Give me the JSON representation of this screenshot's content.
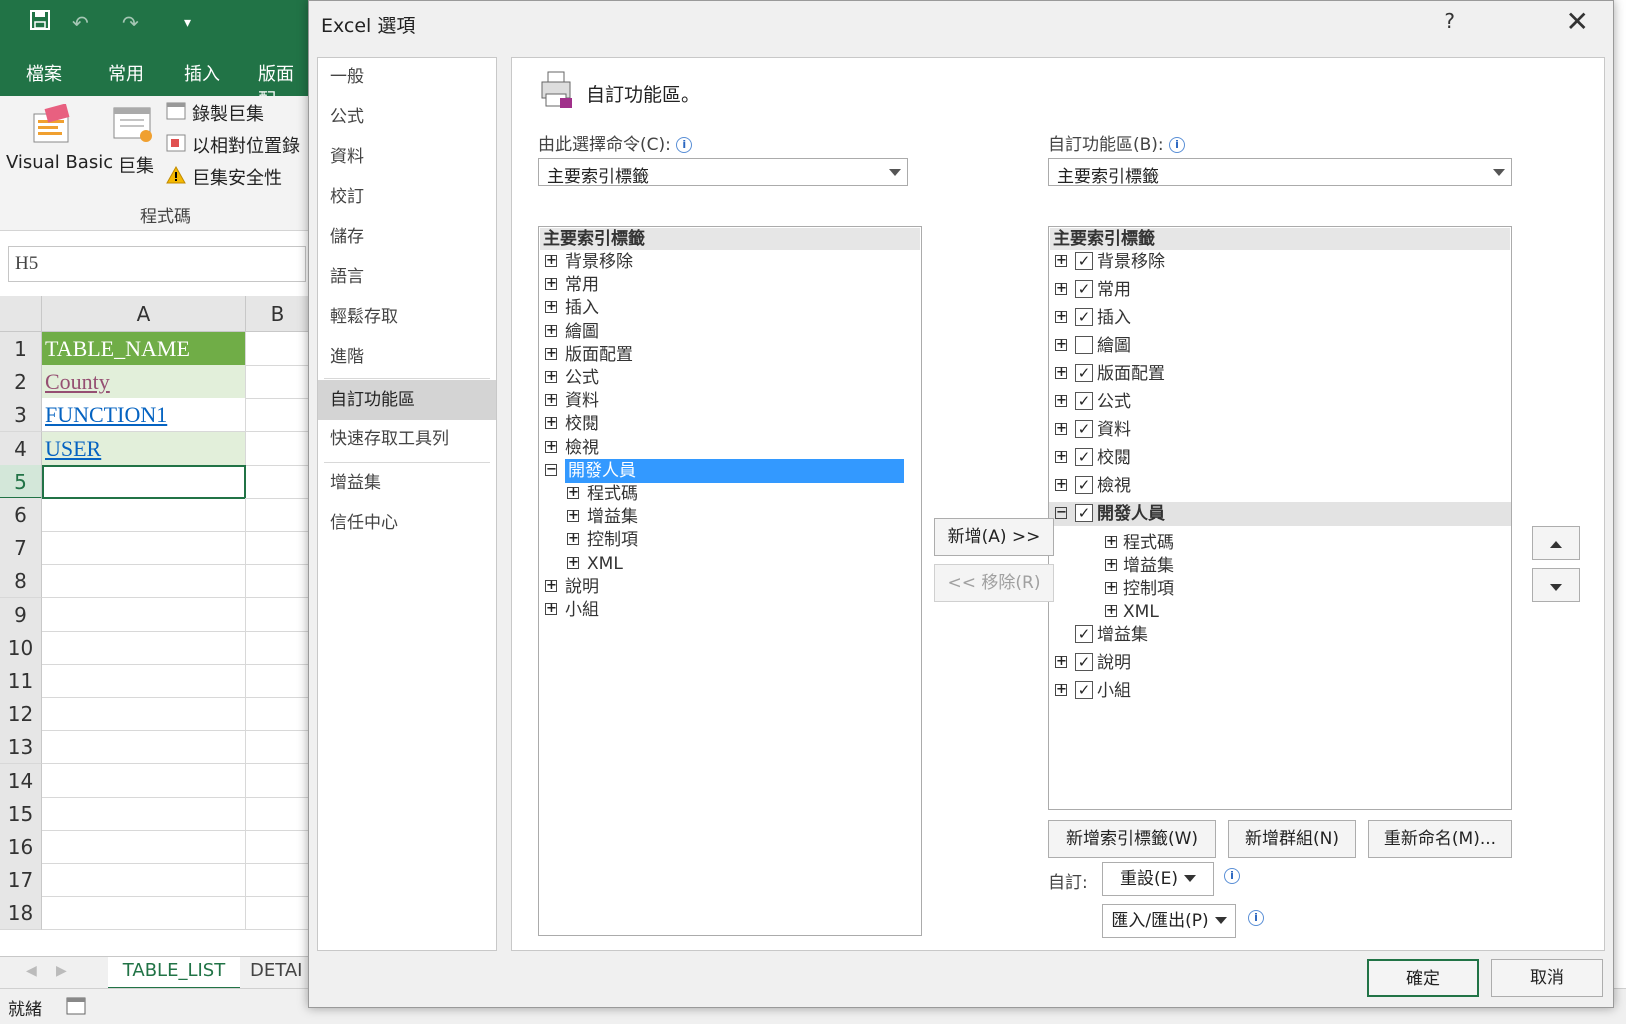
{
  "excel": {
    "tabs": [
      "檔案",
      "常用",
      "插入",
      "版面配"
    ],
    "ribbon": {
      "vb": "Visual Basic",
      "macros": "巨集",
      "record": "錄製巨集",
      "relative": "以相對位置錄",
      "security": "巨集安全性",
      "group": "程式碼"
    },
    "namebox": "H5",
    "col_a": "A",
    "col_b": "B",
    "rows": [
      "1",
      "2",
      "3",
      "4",
      "5",
      "6",
      "7",
      "8",
      "9",
      "10",
      "11",
      "12",
      "13",
      "14",
      "15",
      "16",
      "17",
      "18"
    ],
    "cells": [
      "TABLE_NAME",
      "County",
      "FUNCTION1",
      "USER"
    ],
    "sheets": [
      "TABLE_LIST",
      "DETAI"
    ],
    "status": "就緒",
    "colors": {
      "green": "#217346",
      "header_fill": "#70ad47",
      "row_fill": "#e2efda",
      "link": "#0563c1",
      "visited": "#954f72"
    }
  },
  "dialog": {
    "title": "Excel 選項",
    "help": "?",
    "close": "✕",
    "nav": [
      "一般",
      "公式",
      "資料",
      "校訂",
      "儲存",
      "語言",
      "輕鬆存取",
      "進階",
      "自訂功能區",
      "快速存取工具列",
      "增益集",
      "信任中心"
    ],
    "heading": "自訂功能區。",
    "left_label": "由此選擇命令(C):",
    "right_label": "自訂功能區(B):",
    "left_combo": "主要索引標籤",
    "right_combo": "主要索引標籤",
    "left_tree": {
      "header": "主要索引標籤",
      "items": [
        {
          "label": "背景移除",
          "exp": "+"
        },
        {
          "label": "常用",
          "exp": "+"
        },
        {
          "label": "插入",
          "exp": "+"
        },
        {
          "label": "繪圖",
          "exp": "+"
        },
        {
          "label": "版面配置",
          "exp": "+"
        },
        {
          "label": "公式",
          "exp": "+"
        },
        {
          "label": "資料",
          "exp": "+"
        },
        {
          "label": "校閱",
          "exp": "+"
        },
        {
          "label": "檢視",
          "exp": "+"
        },
        {
          "label": "開發人員",
          "exp": "−"
        },
        {
          "label": "程式碼",
          "exp": "+"
        },
        {
          "label": "增益集",
          "exp": "+"
        },
        {
          "label": "控制項",
          "exp": "+"
        },
        {
          "label": "XML",
          "exp": "+"
        },
        {
          "label": "說明",
          "exp": "+"
        },
        {
          "label": "小組",
          "exp": "+"
        }
      ]
    },
    "right_tree": {
      "header": "主要索引標籤",
      "items": [
        {
          "label": "背景移除",
          "exp": "+",
          "checked": "✓"
        },
        {
          "label": "常用",
          "exp": "+",
          "checked": "✓"
        },
        {
          "label": "插入",
          "exp": "+",
          "checked": "✓"
        },
        {
          "label": "繪圖",
          "exp": "+",
          "checked": ""
        },
        {
          "label": "版面配置",
          "exp": "+",
          "checked": "✓"
        },
        {
          "label": "公式",
          "exp": "+",
          "checked": "✓"
        },
        {
          "label": "資料",
          "exp": "+",
          "checked": "✓"
        },
        {
          "label": "校閱",
          "exp": "+",
          "checked": "✓"
        },
        {
          "label": "檢視",
          "exp": "+",
          "checked": "✓"
        },
        {
          "label": "開發人員",
          "exp": "−",
          "checked": "✓"
        },
        {
          "label": "程式碼",
          "exp": "+"
        },
        {
          "label": "增益集",
          "exp": "+"
        },
        {
          "label": "控制項",
          "exp": "+"
        },
        {
          "label": "XML",
          "exp": "+"
        },
        {
          "label": "增益集",
          "checked": "✓"
        },
        {
          "label": "說明",
          "exp": "+",
          "checked": "✓"
        },
        {
          "label": "小組",
          "exp": "+",
          "checked": "✓"
        }
      ]
    },
    "add_button": "新增(A) >>",
    "remove_button": "<< 移除(R)",
    "new_tab_button": "新增索引標籤(W)",
    "new_group_button": "新增群組(N)",
    "rename_button": "重新命名(M)...",
    "customize_label": "自訂:",
    "reset_button": "重設(E)",
    "import_export_button": "匯入/匯出(P)",
    "ok_button": "確定",
    "cancel_button": "取消",
    "info_glyph": "i"
  }
}
